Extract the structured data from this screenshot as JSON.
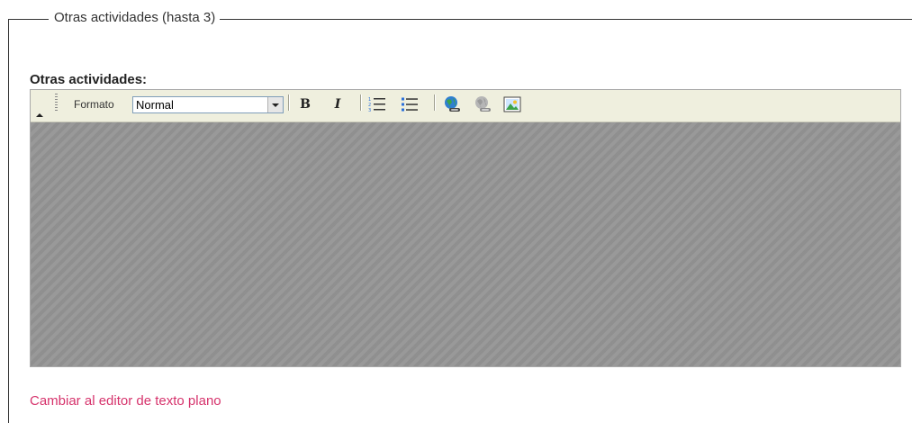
{
  "fieldset": {
    "legend": "Otras actividades (hasta 3)"
  },
  "field": {
    "label": "Otras actividades:"
  },
  "editor": {
    "toolbar": {
      "format_label": "Formato",
      "format_value": "Normal",
      "buttons": {
        "bold": "B",
        "italic": "I"
      },
      "icons": [
        "collapse-toolbar-icon",
        "bold-icon",
        "italic-icon",
        "ordered-list-icon",
        "unordered-list-icon",
        "insert-link-icon",
        "remove-link-icon",
        "insert-image-icon"
      ]
    },
    "content_value": ""
  },
  "links": {
    "switch_editor": "Cambiar al editor de texto plano"
  },
  "colors": {
    "link": "#d6336c",
    "toolbar_bg": "#efefde",
    "content_bg": "#949494"
  }
}
